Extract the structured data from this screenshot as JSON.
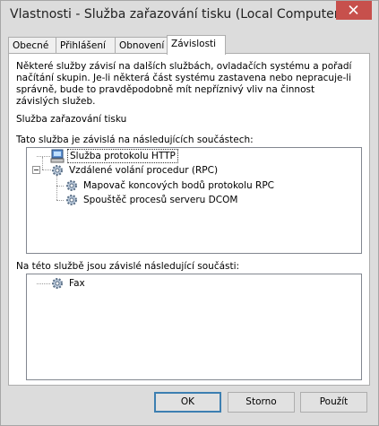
{
  "window": {
    "title": "Vlastnosti - Služba zařazování tisku (Local Computer)"
  },
  "tabs": [
    {
      "label": "Obecné"
    },
    {
      "label": "Přihlášení"
    },
    {
      "label": "Obnovení"
    },
    {
      "label": "Závislosti",
      "active": true
    }
  ],
  "panel": {
    "description": "Některé služby závisí na dalších službách, ovladačích systému a pořadí načítání skupin. Je-li některá část systému zastavena nebo nepracuje-li správně, bude to pravděpodobně mít nepříznivý vliv na činnost závislých služeb.",
    "service_name": "Služba zařazování tisku",
    "depends_on_label": "Tato služba je závislá na následujících součástech:",
    "depends_on": [
      {
        "label": "Služba protokolu HTTP",
        "icon": "computer-icon",
        "selected": true
      },
      {
        "label": "Vzdálené volání procedur (RPC)",
        "icon": "service-gear-icon",
        "expanded": true,
        "children": [
          {
            "label": "Mapovač koncových bodů protokolu RPC",
            "icon": "service-gear-icon"
          },
          {
            "label": "Spouštěč procesů serveru DCOM",
            "icon": "service-gear-icon"
          }
        ]
      }
    ],
    "dependents_label": "Na této službě jsou závislé následující součásti:",
    "dependents": [
      {
        "label": "Fax",
        "icon": "service-gear-icon"
      }
    ]
  },
  "buttons": {
    "ok": "OK",
    "cancel": "Storno",
    "apply": "Použít"
  }
}
